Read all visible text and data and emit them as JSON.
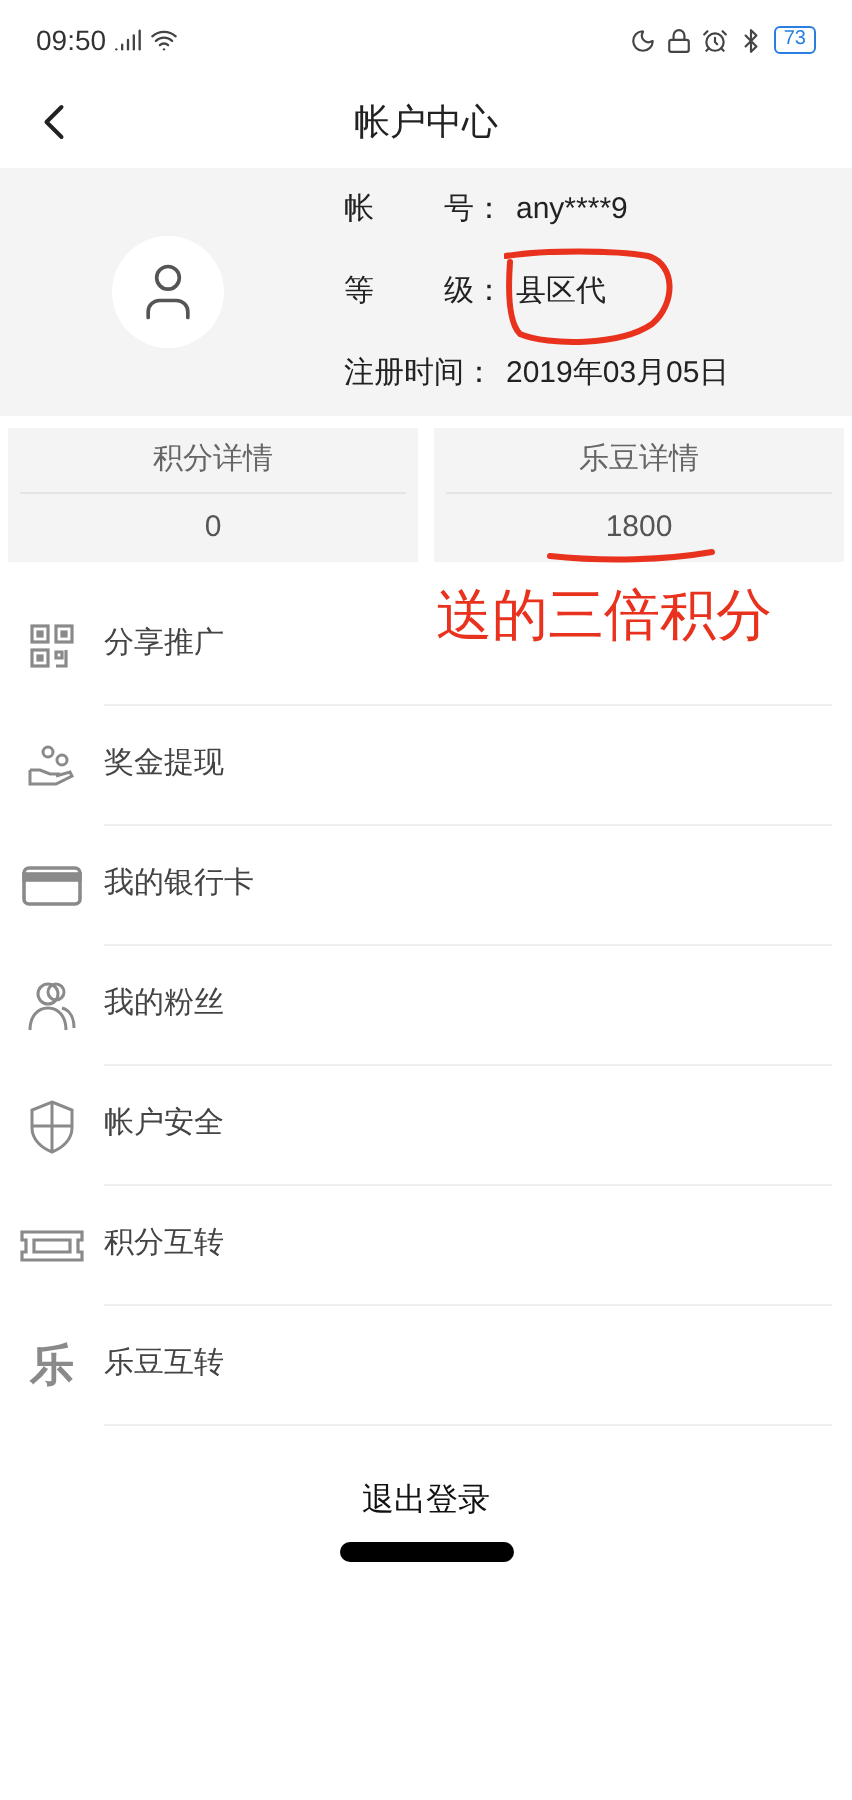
{
  "status_bar": {
    "time": "09:50",
    "battery": "73"
  },
  "header": {
    "title": "帐户中心"
  },
  "profile": {
    "fields": [
      {
        "label": "帐",
        "label2": "号：",
        "value": "any****9"
      },
      {
        "label": "等",
        "label2": "级：",
        "value": "县区代"
      },
      {
        "label": "注册时间：",
        "value": "2019年03月05日"
      }
    ]
  },
  "stats": [
    {
      "label": "积分详情",
      "value": "0"
    },
    {
      "label": "乐豆详情",
      "value": "1800"
    }
  ],
  "annotation": {
    "text": "送的三倍积分"
  },
  "menu": [
    {
      "kind": "qr",
      "label": "分享推广"
    },
    {
      "kind": "hand",
      "label": "奖金提现"
    },
    {
      "kind": "card",
      "label": "我的银行卡"
    },
    {
      "kind": "fans",
      "label": "我的粉丝"
    },
    {
      "kind": "shield",
      "label": "帐户安全"
    },
    {
      "kind": "ticket",
      "label": "积分互转"
    },
    {
      "kind": "char",
      "glyph": "乐",
      "label": "乐豆互转"
    }
  ],
  "logout": {
    "label": "退出登录"
  }
}
